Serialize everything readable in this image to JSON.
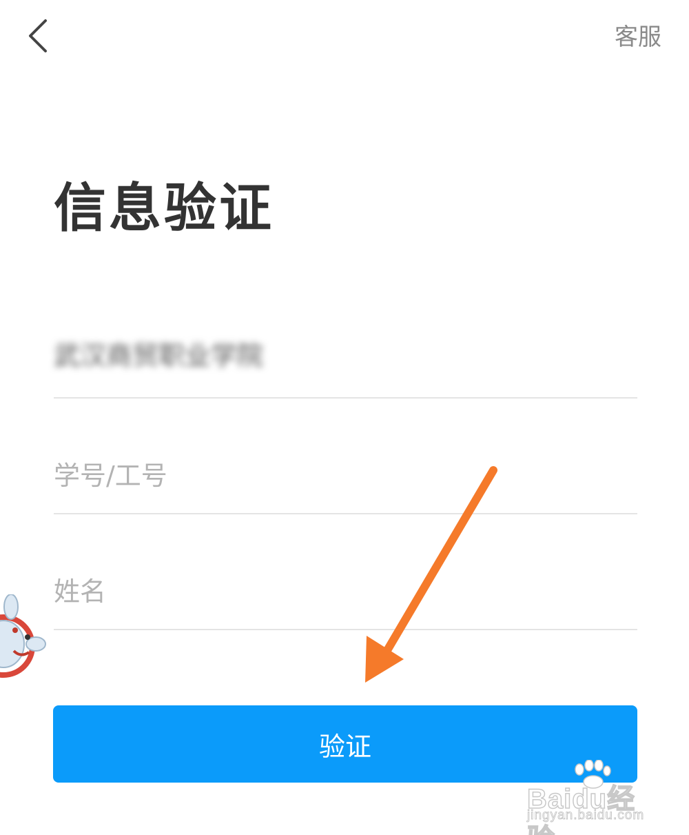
{
  "header": {
    "back_icon": "chevron-left-icon",
    "service_label": "客服"
  },
  "page": {
    "title": "信息验证"
  },
  "form": {
    "school_value": "武汉商贸职业学院",
    "id_placeholder": "学号/工号",
    "name_placeholder": "姓名",
    "submit_label": "验证"
  },
  "colors": {
    "accent": "#0b9bfa",
    "annotation_arrow": "#f57a2a",
    "placeholder": "#b3b3b3"
  },
  "watermark": {
    "logo": "Baidu经验",
    "url": "jingyan.baidu.com"
  }
}
